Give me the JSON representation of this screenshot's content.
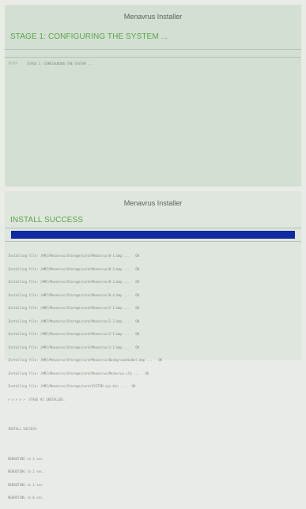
{
  "stage1": {
    "title": "Menavrus Installer",
    "status": "STAGE 1: CONFIGURING THE SYSTEM ...",
    "log": "?????     STAGE 1: CONFIGURING THE SYSTEM ..."
  },
  "install": {
    "title": "Menavrus Installer",
    "status": "INSTALL SUCCESS",
    "progress_fraction": 1.0,
    "log_lines": [
      "Installing file: /HMI/Menavrus/Storage/card/Menavrus/0-1.bmp ...   OK",
      "Installing file: /HMI/Menavrus/Storage/card/Menavrus/0-2.bmp ...   OK",
      "Installing file: /HMI/Menavrus/Storage/card/Menavrus/0-3.bmp ...   OK",
      "Installing file: /HMI/Menavrus/Storage/card/Menavrus/0-4.bmp ...   OK",
      "Installing file: /HMI/Menavrus/Storage/card/Menavrus/1-1.bmp ...   OK",
      "Installing file: /HMI/Menavrus/Storage/card/Menavrus/1-2.bmp ...   OK",
      "Installing file: /HMI/Menavrus/Storage/card/Menavrus/2-1.bmp ...   OK",
      "Installing file: /HMI/Menavrus/Storage/card/Menavrus/3-1.bmp ...   OK",
      "Installing file: /HMI/Menavrus/Storage/card/Menavrus/BackgroundLabel.bmp ...   OK",
      "Installing file: /HMI/Menavrus/Storage/card/Menavrus/Menavrus.cfg ...   OK",
      "Installing file: /HMI/Menavrus/Storage/card/SYSTEM.sys.bin ...   OK",
      "> > > > >  STAGE #1 INSTALLED."
    ],
    "summary": "INSTALL SUCCESS",
    "reboot_lines": [
      "REBOOTING in 3 sec.",
      "REBOOTING in 2 sec.",
      "REBOOTING in 1 sec.",
      "REBOOTING in 0 sec."
    ]
  }
}
